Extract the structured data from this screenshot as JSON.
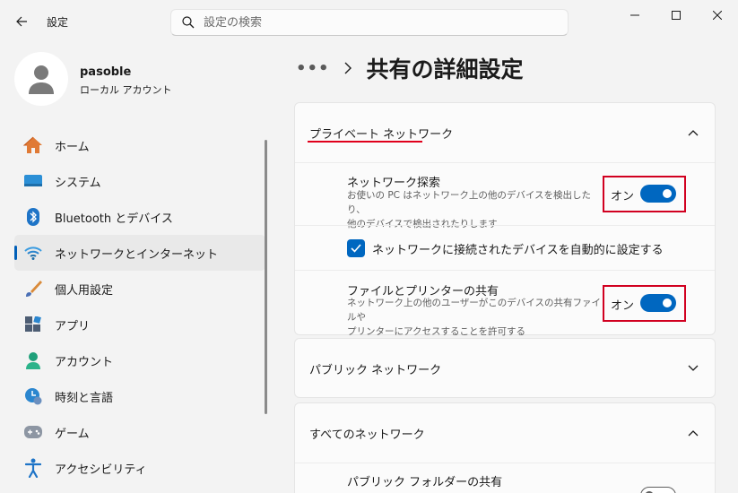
{
  "window": {
    "title": "設定",
    "search_placeholder": "設定の検索"
  },
  "profile": {
    "name": "pasoble",
    "account_type": "ローカル アカウント"
  },
  "sidebar": {
    "items": [
      {
        "label": "ホーム",
        "icon": "home-icon"
      },
      {
        "label": "システム",
        "icon": "system-icon"
      },
      {
        "label": "Bluetooth とデバイス",
        "icon": "bluetooth-icon"
      },
      {
        "label": "ネットワークとインターネット",
        "icon": "network-icon",
        "selected": true
      },
      {
        "label": "個人用設定",
        "icon": "brush-icon"
      },
      {
        "label": "アプリ",
        "icon": "apps-icon"
      },
      {
        "label": "アカウント",
        "icon": "account-icon"
      },
      {
        "label": "時刻と言語",
        "icon": "time-language-icon"
      },
      {
        "label": "ゲーム",
        "icon": "game-icon"
      },
      {
        "label": "アクセシビリティ",
        "icon": "accessibility-icon"
      }
    ]
  },
  "main": {
    "breadcrumb_more": "•••",
    "page_title": "共有の詳細設定",
    "private_network": {
      "label": "プライベート ネットワーク",
      "network_discovery": {
        "title": "ネットワーク探索",
        "desc_line1": "お使いの PC はネットワーク上の他のデバイスを検出したり、",
        "desc_line2": "他のデバイスで検出されたりします",
        "state": "オン"
      },
      "auto_setup": {
        "label": "ネットワークに接続されたデバイスを自動的に設定する",
        "checked": true
      },
      "file_printer_sharing": {
        "title": "ファイルとプリンターの共有",
        "desc_line1": "ネットワーク上の他のユーザーがこのデバイスの共有ファイルや",
        "desc_line2": "プリンターにアクセスすることを許可する",
        "state": "オン"
      }
    },
    "public_network": {
      "label": "パブリック ネットワーク"
    },
    "all_networks": {
      "label": "すべてのネットワーク",
      "public_folder_sharing": {
        "title": "パブリック フォルダーの共有"
      }
    }
  },
  "colors": {
    "accent": "#0067c0",
    "highlight_red": "#d10020"
  }
}
